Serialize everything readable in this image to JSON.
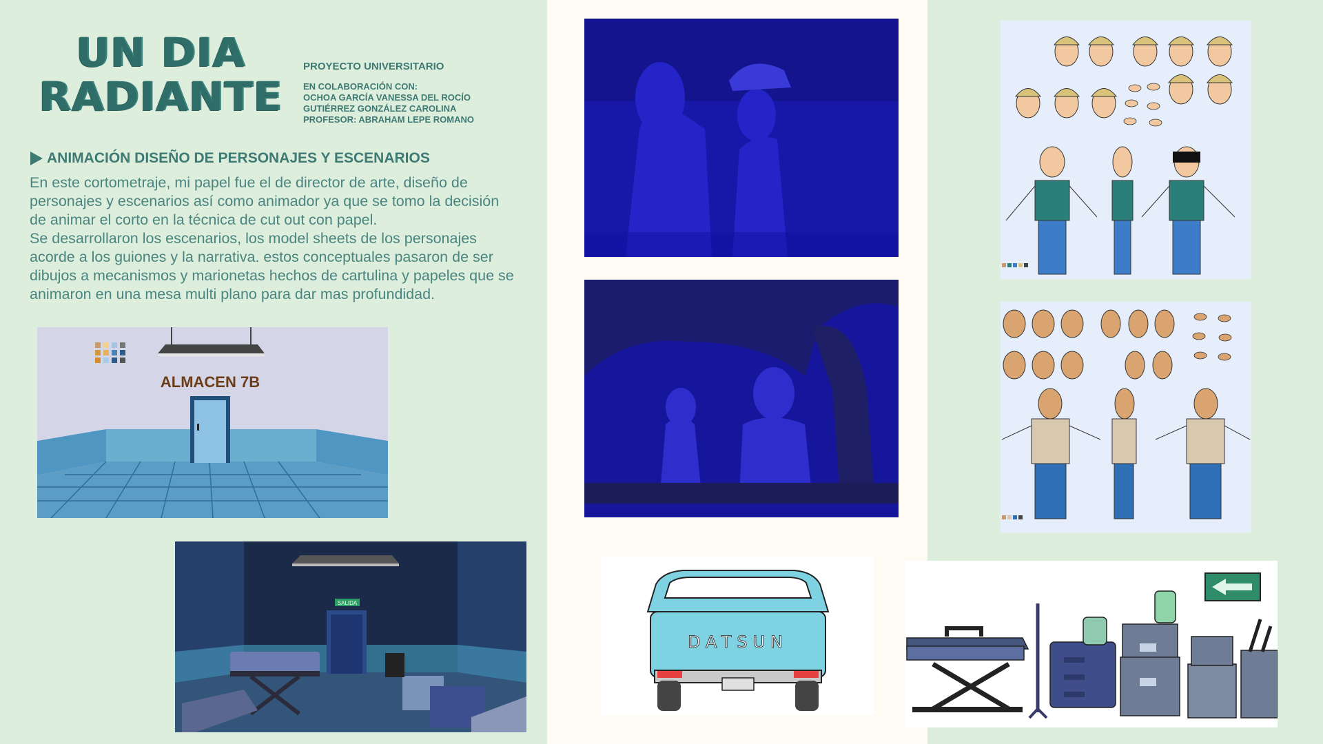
{
  "title": {
    "line1": "UN DIA",
    "line2": "RADIANTE"
  },
  "project": "PROYECTO UNIVERSITARIO",
  "collaboration": {
    "heading": "EN COLABORACIÓN CON:",
    "people": [
      "OCHOA GARCÍA VANESSA DEL ROCÍO",
      "GUTIÉRREZ GONZÁLEZ CAROLINA",
      "PROFESOR: ABRAHAM LEPE ROMANO"
    ]
  },
  "section": {
    "heading": "ANIMACIÓN  DISEÑO DE PERSONAJES  Y ESCENARIOS"
  },
  "body": {
    "lines": [
      "En este cortometraje, mi papel fue el de director de arte, diseño de",
      "personajes y escenarios así como animador  ya que se tomo la decisión",
      "de animar el corto en la técnica de cut out con papel.",
      "Se desarrollaron los escenarios, los model sheets de los personajes",
      "acorde a los guiones y la narrativa.  estos conceptuales pasaron de ser",
      "dibujos a mecanismos y marionetas  hechos de cartulina y papeles que se",
      "animaron en una mesa multi plano para dar mas profundidad."
    ]
  },
  "scenes": {
    "warehouse_sign": "ALMACEN 7B",
    "exit_sign": "SALIDA"
  },
  "truck": {
    "brand": "DATSUN"
  },
  "colors": {
    "bg": "#ddeedd",
    "accent": "#3e7a74",
    "middle_column": "#fefaf4",
    "night_blue": "#1b1b9e"
  }
}
